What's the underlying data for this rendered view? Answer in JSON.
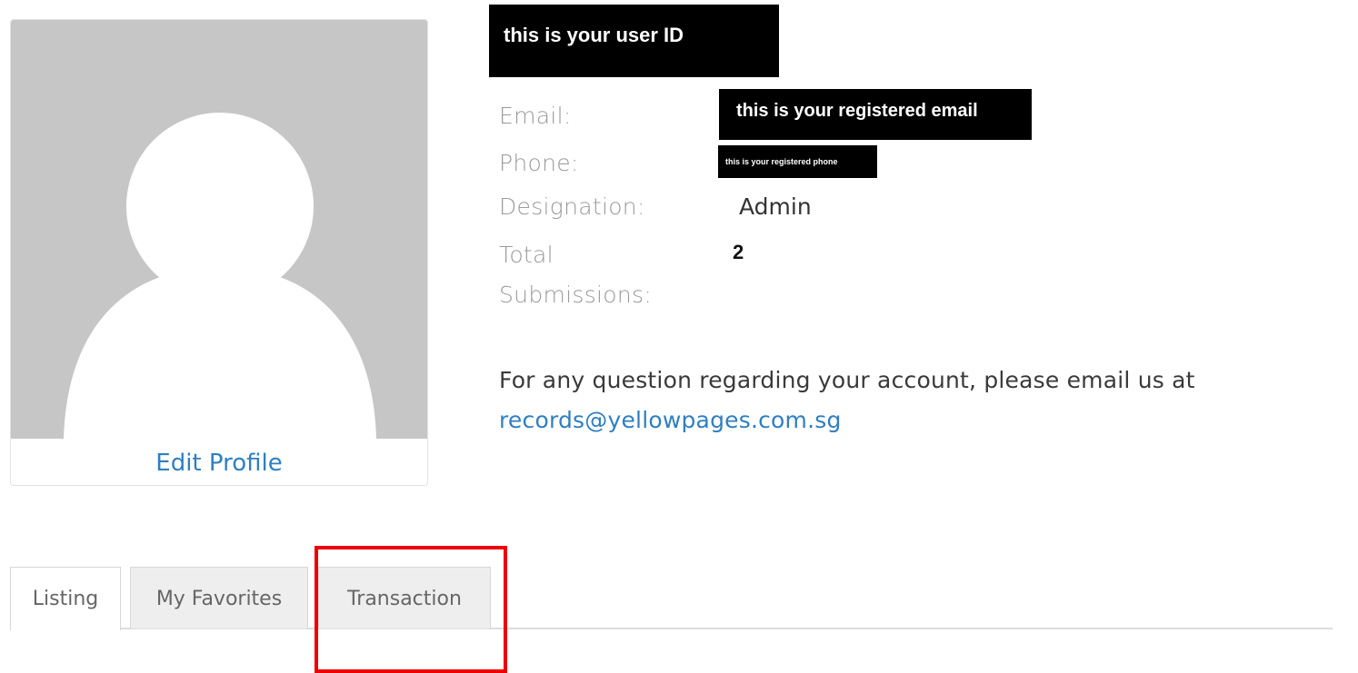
{
  "profile": {
    "user_id_redaction": "this is your user ID",
    "edit_profile_label": "Edit Profile"
  },
  "info": {
    "email_label": "Email:",
    "email_redaction": "this is your registered email",
    "phone_label": "Phone:",
    "phone_redaction": "this is your registered phone",
    "designation_label": "Designation:",
    "designation_value": "Admin",
    "total_label_line1": "Total",
    "total_label_line2": "Submissions:",
    "total_value": "2"
  },
  "contact": {
    "text": "For any question regarding your account, please email us at",
    "email_link": "records@yellowpages.com.sg"
  },
  "tabs": [
    {
      "label": "Listing",
      "active": true
    },
    {
      "label": "My Favorites",
      "active": false
    },
    {
      "label": "Transaction",
      "active": false
    }
  ],
  "colors": {
    "link": "#2f7fc1",
    "avatar_bg": "#c6c6c6",
    "highlight": "#ee0000",
    "redaction": "#000000"
  },
  "icons": {
    "avatar": "default-user-silhouette"
  }
}
